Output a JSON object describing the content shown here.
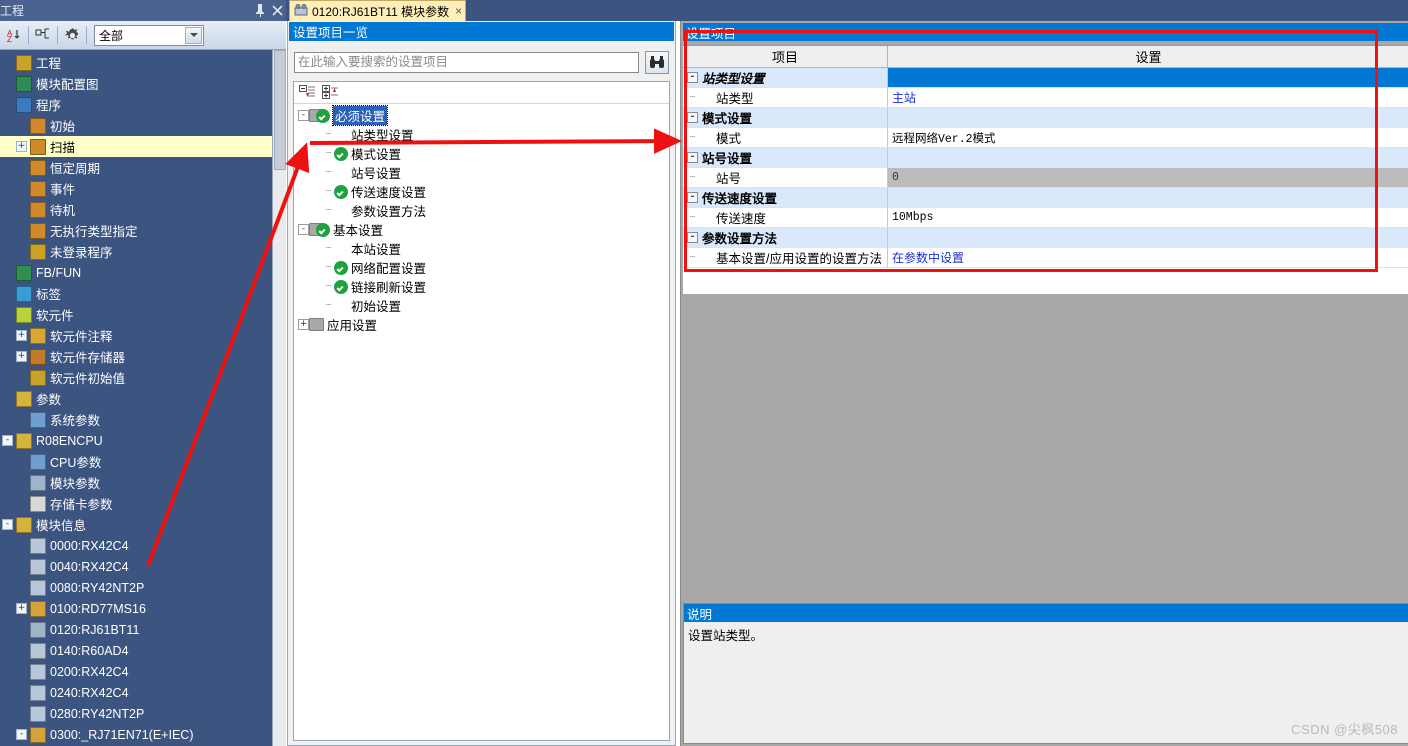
{
  "nav": {
    "title": "工程",
    "pin_icon": "pin-icon",
    "close_icon": "close-icon",
    "toolbar": {
      "sort_icon": "sort-icon",
      "view_icon": "view-layout-icon",
      "gear_icon": "gear-icon",
      "filter_value": "全部"
    },
    "items": [
      {
        "label": "工程",
        "indent": 0,
        "exp": "",
        "icon": "project-icon",
        "color": "#c9a227",
        "selected": false
      },
      {
        "label": "模块配置图",
        "indent": 0,
        "exp": "",
        "icon": "module-config-icon",
        "color": "#2e8b57",
        "selected": false
      },
      {
        "label": "程序",
        "indent": 0,
        "exp": "",
        "icon": "program-icon",
        "color": "#3a7bbf",
        "selected": false
      },
      {
        "label": "初始",
        "indent": 1,
        "exp": "",
        "icon": "program-block-icon",
        "color": "#d08a2b",
        "selected": false
      },
      {
        "label": "扫描",
        "indent": 1,
        "exp": "+",
        "icon": "program-block-icon",
        "color": "#d08a2b",
        "selected": true
      },
      {
        "label": "恒定周期",
        "indent": 1,
        "exp": "",
        "icon": "program-block-icon",
        "color": "#d08a2b",
        "selected": false
      },
      {
        "label": "事件",
        "indent": 1,
        "exp": "",
        "icon": "program-block-icon",
        "color": "#d08a2b",
        "selected": false
      },
      {
        "label": "待机",
        "indent": 1,
        "exp": "",
        "icon": "program-block-icon",
        "color": "#d08a2b",
        "selected": false
      },
      {
        "label": "无执行类型指定",
        "indent": 1,
        "exp": "",
        "icon": "program-block-icon",
        "color": "#d08a2b",
        "selected": false
      },
      {
        "label": "未登录程序",
        "indent": 1,
        "exp": "",
        "icon": "unregistered-icon",
        "color": "#c9a227",
        "selected": false
      },
      {
        "label": "FB/FUN",
        "indent": 0,
        "exp": "",
        "icon": "fb-fun-icon",
        "color": "#2f8f4f",
        "selected": false
      },
      {
        "label": "标签",
        "indent": 0,
        "exp": "",
        "icon": "label-icon",
        "color": "#3a9bd5",
        "selected": false
      },
      {
        "label": "软元件",
        "indent": 0,
        "exp": "",
        "icon": "device-icon",
        "color": "#b9d23a",
        "selected": false
      },
      {
        "label": "软元件注释",
        "indent": 1,
        "exp": "+",
        "icon": "comment-icon",
        "color": "#d9a834",
        "selected": false
      },
      {
        "label": "软元件存储器",
        "indent": 1,
        "exp": "+",
        "icon": "memory-icon",
        "color": "#c07c2a",
        "selected": false
      },
      {
        "label": "软元件初始值",
        "indent": 1,
        "exp": "",
        "icon": "initial-value-icon",
        "color": "#c9a227",
        "selected": false
      },
      {
        "label": "参数",
        "indent": 0,
        "exp": "",
        "icon": "parameter-icon",
        "color": "#d6b33a",
        "selected": false
      },
      {
        "label": "系统参数",
        "indent": 1,
        "exp": "",
        "icon": "sys-param-icon",
        "color": "#6f9ed0",
        "selected": false
      },
      {
        "label": "R08ENCPU",
        "indent": 0,
        "exp": "-",
        "icon": "cpu-icon",
        "color": "#d6b33a",
        "selected": false
      },
      {
        "label": "CPU参数",
        "indent": 1,
        "exp": "",
        "icon": "cpu-param-icon",
        "color": "#6f9ed0",
        "selected": false
      },
      {
        "label": "模块参数",
        "indent": 1,
        "exp": "",
        "icon": "module-param-icon",
        "color": "#9fb3c9",
        "selected": false
      },
      {
        "label": "存储卡参数",
        "indent": 1,
        "exp": "",
        "icon": "memcard-icon",
        "color": "#d8d8d8",
        "selected": false
      },
      {
        "label": "模块信息",
        "indent": 0,
        "exp": "-",
        "icon": "module-info-icon",
        "color": "#d6b33a",
        "selected": false
      },
      {
        "label": "0000:RX42C4",
        "indent": 1,
        "exp": "",
        "icon": "module-icon",
        "color": "#b7c6d8",
        "selected": false
      },
      {
        "label": "0040:RX42C4",
        "indent": 1,
        "exp": "",
        "icon": "module-icon",
        "color": "#b7c6d8",
        "selected": false
      },
      {
        "label": "0080:RY42NT2P",
        "indent": 1,
        "exp": "",
        "icon": "module-icon",
        "color": "#b7c6d8",
        "selected": false
      },
      {
        "label": "0100:RD77MS16",
        "indent": 1,
        "exp": "+",
        "icon": "module-icon",
        "color": "#d6a23a",
        "selected": false
      },
      {
        "label": "0120:RJ61BT11",
        "indent": 1,
        "exp": "",
        "icon": "module-icon",
        "color": "#9fb3c9",
        "selected": false
      },
      {
        "label": "0140:R60AD4",
        "indent": 1,
        "exp": "",
        "icon": "module-icon",
        "color": "#b7c6d8",
        "selected": false
      },
      {
        "label": "0200:RX42C4",
        "indent": 1,
        "exp": "",
        "icon": "module-icon",
        "color": "#b7c6d8",
        "selected": false
      },
      {
        "label": "0240:RX42C4",
        "indent": 1,
        "exp": "",
        "icon": "module-icon",
        "color": "#b7c6d8",
        "selected": false
      },
      {
        "label": "0280:RY42NT2P",
        "indent": 1,
        "exp": "",
        "icon": "module-icon",
        "color": "#b7c6d8",
        "selected": false
      },
      {
        "label": "0300:_RJ71EN71(E+IEC)",
        "indent": 1,
        "exp": "-",
        "icon": "module-icon",
        "color": "#d6a23a",
        "selected": false
      }
    ]
  },
  "tab": {
    "icon": "module-param-icon",
    "label": "0120:RJ61BT11 模块参数",
    "close": "×"
  },
  "middle": {
    "header": "设置项目一览",
    "search_placeholder": "在此输入要搜索的设置项目",
    "search_value": "",
    "search_icon": "binoculars-icon",
    "collapse_icon": "collapse-all-icon",
    "expand_icon": "expand-all-icon",
    "tree": [
      {
        "label": "必须设置",
        "level": 0,
        "exp": "-",
        "check": true,
        "folder": true,
        "selected": true
      },
      {
        "label": "站类型设置",
        "level": 1,
        "exp": "",
        "check": false,
        "folder": false,
        "selected": false
      },
      {
        "label": "模式设置",
        "level": 1,
        "exp": "",
        "check": true,
        "folder": false,
        "selected": false
      },
      {
        "label": "站号设置",
        "level": 1,
        "exp": "",
        "check": false,
        "folder": false,
        "selected": false
      },
      {
        "label": "传送速度设置",
        "level": 1,
        "exp": "",
        "check": true,
        "folder": false,
        "selected": false
      },
      {
        "label": "参数设置方法",
        "level": 1,
        "exp": "",
        "check": false,
        "folder": false,
        "selected": false
      },
      {
        "label": "基本设置",
        "level": 0,
        "exp": "-",
        "check": true,
        "folder": true,
        "selected": false
      },
      {
        "label": "本站设置",
        "level": 1,
        "exp": "",
        "check": false,
        "folder": false,
        "selected": false
      },
      {
        "label": "网络配置设置",
        "level": 1,
        "exp": "",
        "check": true,
        "folder": false,
        "selected": false
      },
      {
        "label": "链接刷新设置",
        "level": 1,
        "exp": "",
        "check": true,
        "folder": false,
        "selected": false
      },
      {
        "label": "初始设置",
        "level": 1,
        "exp": "",
        "check": false,
        "folder": false,
        "selected": false
      },
      {
        "label": "应用设置",
        "level": 0,
        "exp": "+",
        "check": false,
        "folder": true,
        "selected": false
      }
    ]
  },
  "right": {
    "header": "设置项目",
    "columns": {
      "item": "项目",
      "setting": "设置"
    },
    "rows": [
      {
        "type": "group",
        "label": "站类型设置",
        "value": "",
        "selected": true,
        "readonly": false,
        "value_style": "normal"
      },
      {
        "type": "child",
        "label": "站类型",
        "value": "主站",
        "selected": false,
        "readonly": false,
        "value_style": "blue"
      },
      {
        "type": "group",
        "label": "模式设置",
        "value": "",
        "selected": false,
        "readonly": false,
        "value_style": "normal"
      },
      {
        "type": "child",
        "label": "模式",
        "value": "远程网络Ver.2模式",
        "selected": false,
        "readonly": false,
        "value_style": "mono"
      },
      {
        "type": "group",
        "label": "站号设置",
        "value": "",
        "selected": false,
        "readonly": false,
        "value_style": "normal"
      },
      {
        "type": "child",
        "label": "站号",
        "value": "0",
        "selected": false,
        "readonly": true,
        "value_style": "mono"
      },
      {
        "type": "group",
        "label": "传送速度设置",
        "value": "",
        "selected": false,
        "readonly": false,
        "value_style": "normal"
      },
      {
        "type": "child",
        "label": "传送速度",
        "value": "10Mbps",
        "selected": false,
        "readonly": false,
        "value_style": "mono"
      },
      {
        "type": "group",
        "label": "参数设置方法",
        "value": "",
        "selected": false,
        "readonly": false,
        "value_style": "normal"
      },
      {
        "type": "child",
        "label": "基本设置/应用设置的设置方法",
        "value": "在参数中设置",
        "selected": false,
        "readonly": false,
        "value_style": "blue"
      }
    ],
    "description": {
      "header": "说明",
      "text": "设置站类型。"
    }
  },
  "watermark": "CSDN @尖枫508",
  "colors": {
    "header_blue": "#0078d4",
    "nav_bg": "#3c5480",
    "selected_row": "#ffffc8",
    "group_row": "#d9e8fb",
    "readonly_cell": "#bcbcbc",
    "annotation_red": "#ee1111",
    "link_blue": "#1a2fd0"
  }
}
